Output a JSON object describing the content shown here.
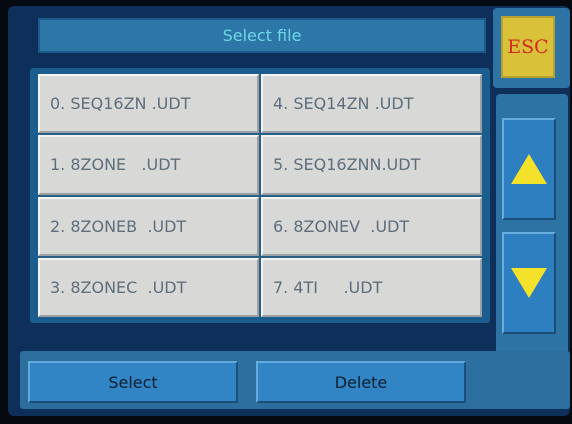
{
  "title": "Select file",
  "esc_label": "ESC",
  "files": [
    "0. SEQ16ZN .UDT",
    "4. SEQ14ZN .UDT",
    "1. 8ZONE   .UDT",
    "5. SEQ16ZNN.UDT",
    "2. 8ZONEB  .UDT",
    "6. 8ZONEV  .UDT",
    "3. 8ZONEC  .UDT",
    "7. 4TI     .UDT"
  ],
  "scroll": {
    "up_icon": "triangle-up-icon",
    "down_icon": "triangle-down-icon",
    "arrow_color": "#f4e12a"
  },
  "actions": {
    "select_label": "Select",
    "delete_label": "Delete"
  }
}
